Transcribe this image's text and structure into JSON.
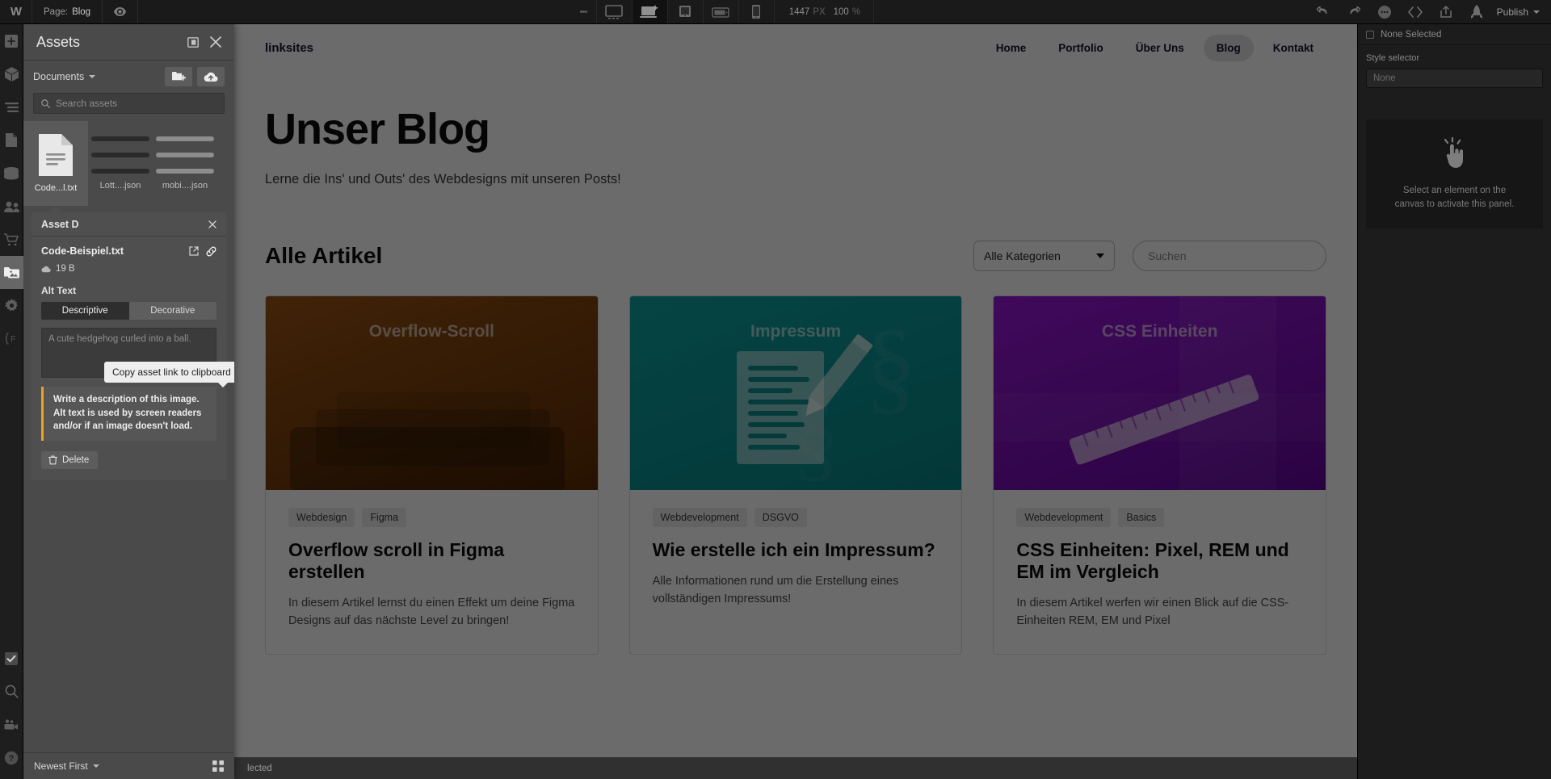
{
  "topbar": {
    "logo": "W",
    "page_label": "Page:",
    "page_name": "Blog",
    "eye_icon": "eye-icon",
    "breakpoints": [
      {
        "name": "desktop-large-breakpoint",
        "active": false
      },
      {
        "name": "desktop-breakpoint",
        "active": true
      },
      {
        "name": "tablet-breakpoint",
        "active": false
      },
      {
        "name": "mobile-landscape-breakpoint",
        "active": false
      },
      {
        "name": "mobile-portrait-breakpoint",
        "active": false
      }
    ],
    "canvas_width": "1447",
    "canvas_width_unit": "PX",
    "zoom": "100",
    "zoom_unit": "%",
    "undo_icon": "undo-icon",
    "redo_icon": "redo-icon",
    "more_icon": "more-dots-icon",
    "code_icon": "code-icon",
    "share_icon": "share-icon",
    "rocket_icon": "rocket-icon",
    "publish_label": "Publish"
  },
  "rail": {
    "items": [
      {
        "name": "add-elements-icon",
        "selected": false
      },
      {
        "name": "components-icon",
        "selected": false
      },
      {
        "name": "navigator-icon",
        "selected": false
      },
      {
        "name": "pages-icon",
        "selected": false
      },
      {
        "name": "cms-database-icon",
        "selected": false
      },
      {
        "name": "users-icon",
        "selected": false
      },
      {
        "name": "ecommerce-cart-icon",
        "selected": false
      },
      {
        "name": "assets-icon",
        "selected": true
      },
      {
        "name": "settings-gear-icon",
        "selected": false
      },
      {
        "name": "variables-icon",
        "selected": false
      }
    ],
    "bottom_items": [
      {
        "name": "audit-checkbox-icon"
      },
      {
        "name": "search-icon"
      },
      {
        "name": "video-tutorials-icon"
      },
      {
        "name": "help-icon"
      }
    ]
  },
  "assets": {
    "title": "Assets",
    "collapse_icon": "panel-collapse-icon",
    "close_icon": "close-icon",
    "folder_dropdown": "Documents",
    "new_folder_icon": "new-folder-icon",
    "upload_icon": "upload-cloud-icon",
    "search_placeholder": "Search assets",
    "search_icon": "search-icon",
    "grid": [
      {
        "name": "Code...l.txt",
        "type": "document",
        "selected": true
      },
      {
        "name": "Lott....json",
        "type": "lottie",
        "selected": false
      },
      {
        "name": "mobi....json",
        "type": "lottie",
        "selected": false
      }
    ],
    "detail": {
      "header": "Asset D",
      "header_full": "Asset Details",
      "close_icon": "close-icon",
      "file_name": "Code-Beispiel.txt",
      "open_icon": "open-external-icon",
      "link_icon": "copy-link-icon",
      "cloud_icon": "cloud-icon",
      "file_size": "19 B",
      "alt_text_label": "Alt Text",
      "segments": [
        {
          "label": "Descriptive",
          "active": true
        },
        {
          "label": "Decorative",
          "active": false
        }
      ],
      "alt_placeholder": "A cute hedgehog curled into a ball.",
      "hint": "Write a description of this image. Alt text is used by screen readers and/or if an image doesn't load.",
      "delete_label": "Delete",
      "delete_icon": "trash-icon"
    },
    "tooltip": "Copy asset link to clipboard",
    "sort_label": "Newest First",
    "grid_view_icon": "grid-view-icon"
  },
  "statusbar": {
    "text": "No elements selected",
    "visible_text": "lected"
  },
  "right_panel": {
    "tabs": [
      {
        "name": "style-panel-tab",
        "icon": "paintbrush-icon",
        "active": true
      },
      {
        "name": "settings-panel-tab",
        "icon": "gear-icon",
        "active": false
      },
      {
        "name": "interactions-panel-tab",
        "icon": "drops-icon",
        "active": false
      },
      {
        "name": "effects-panel-tab",
        "icon": "lightning-icon",
        "active": false
      }
    ],
    "selection_label": "None Selected",
    "style_selector_label": "Style selector",
    "style_selector_value": "None",
    "empty_icon": "pointing-hand-icon",
    "empty_message": "Select an element on the canvas to activate this panel."
  },
  "canvas": {
    "nav": {
      "brand": "linksites",
      "links": [
        {
          "label": "Home",
          "current": false
        },
        {
          "label": "Portfolio",
          "current": false
        },
        {
          "label": "Über Uns",
          "current": false
        },
        {
          "label": "Blog",
          "current": true
        },
        {
          "label": "Kontakt",
          "current": false
        }
      ]
    },
    "hero": {
      "title": "Unser Blog",
      "subtitle": "Lerne die Ins' und Outs' des Webdesigns mit unseren Posts!"
    },
    "section": {
      "heading": "Alle Artikel",
      "category_select": "Alle Kategorien",
      "search_placeholder": "Suchen"
    },
    "cards": [
      {
        "image_title": "Overflow-Scroll",
        "image_color_start": "#8c4a12",
        "image_color_end": "#6b3408",
        "tags": [
          "Webdesign",
          "Figma"
        ],
        "heading": "Overflow scroll in Figma erstellen",
        "excerpt": "In diesem Artikel lernst du einen Effekt um deine Figma Designs auf das nächste Level zu bringen!"
      },
      {
        "image_title": "Impressum",
        "image_color_start": "#0d9494",
        "image_color_end": "#0a8282",
        "tags": [
          "Webdevelopment",
          "DSGVO"
        ],
        "heading": "Wie erstelle ich ein Impressum?",
        "excerpt": "Alle Informationen rund um die Erstellung eines vollständigen Impressums!"
      },
      {
        "image_title": "CSS Einheiten",
        "image_color_start": "#8c12c8",
        "image_color_end": "#6a0aa0",
        "tags": [
          "Webdevelopment",
          "Basics"
        ],
        "heading": "CSS Einheiten: Pixel, REM und EM im Vergleich",
        "excerpt": "In diesem Artikel werfen wir einen Blick auf die CSS-Einheiten REM, EM und Pixel"
      }
    ]
  },
  "colors": {
    "accent_orange": "#f0a020",
    "panel_bg": "#4a4a4a",
    "chrome_bg": "#1a1a1a"
  }
}
